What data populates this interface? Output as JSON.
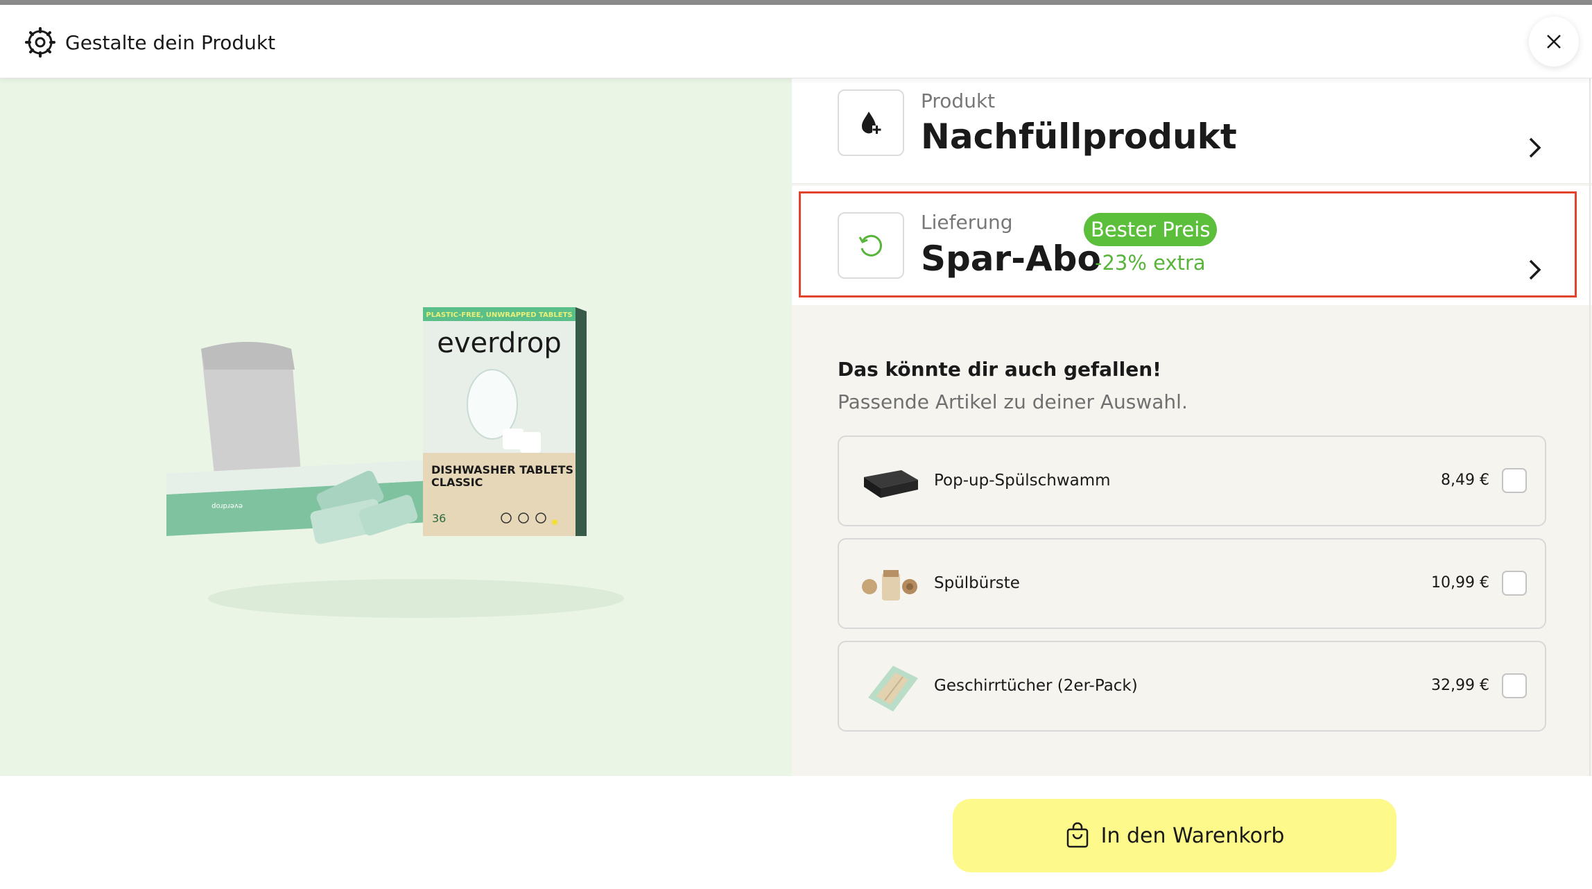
{
  "header": {
    "title": "Gestalte dein Produkt",
    "icon": "gear-icon",
    "close_icon": "close-icon"
  },
  "product_image": {
    "brand": "everdrop",
    "banner": "PLASTIC-FREE, UNWRAPPED TABLETS",
    "name_line1": "DISHWASHER TABLETS",
    "name_line2": "CLASSIC",
    "count": "36"
  },
  "options": {
    "product": {
      "label": "Produkt",
      "value": "Nachfüllprodukt",
      "icon": "refill-drop-icon"
    },
    "delivery": {
      "label": "Lieferung",
      "value": "Spar-Abo",
      "badge": "Bester Preis",
      "extra": "-23% extra",
      "icon": "subscription-refresh-icon"
    }
  },
  "recommendations": {
    "title": "Das könnte dir auch gefallen!",
    "subtitle": "Passende Artikel zu deiner Auswahl.",
    "items": [
      {
        "name": "Pop-up-Spülschwamm",
        "price": "8,49 €",
        "checked": false
      },
      {
        "name": "Spülbürste",
        "price": "10,99 €",
        "checked": false
      },
      {
        "name": "Geschirrtücher (2er-Pack)",
        "price": "32,99 €",
        "checked": false
      }
    ]
  },
  "cart": {
    "label": "In den Warenkorb",
    "icon": "shopping-bag-icon"
  },
  "colors": {
    "accent_green": "#5bbf3c",
    "cart_yellow": "#fdf98a",
    "highlight_red": "#e0442c",
    "preview_bg": "#eaf5e6"
  }
}
